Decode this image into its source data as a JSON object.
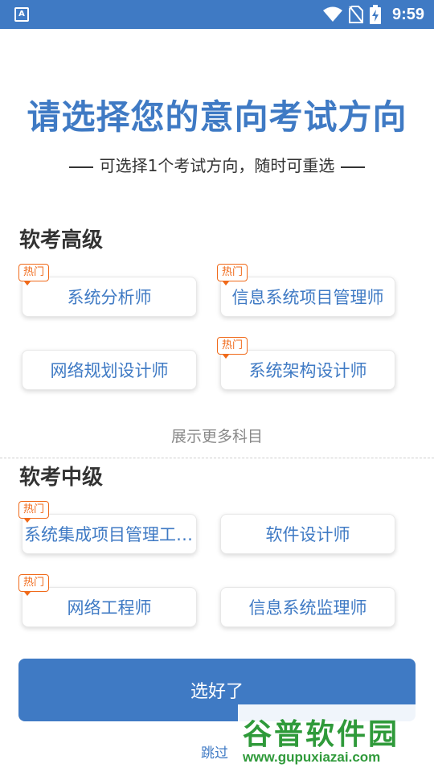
{
  "status_bar": {
    "left_icon": "A",
    "icons": [
      "wifi-icon",
      "no-sim-icon",
      "battery-charging-icon"
    ],
    "time": "9:59"
  },
  "header": {
    "title": "请选择您的意向考试方向",
    "subtitle": "可选择1个考试方向，随时可重选"
  },
  "sections": [
    {
      "title": "软考高级",
      "options": [
        {
          "label": "系统分析师",
          "hot": true
        },
        {
          "label": "信息系统项目管理师",
          "hot": true
        },
        {
          "label": "网络规划设计师",
          "hot": false
        },
        {
          "label": "系统架构设计师",
          "hot": true
        }
      ]
    },
    {
      "title": "软考中级",
      "options": [
        {
          "label": "系统集成项目管理工程师",
          "hot": true
        },
        {
          "label": "软件设计师",
          "hot": false
        },
        {
          "label": "网络工程师",
          "hot": true
        },
        {
          "label": "信息系统监理师",
          "hot": false
        }
      ]
    }
  ],
  "hot_label": "热门",
  "show_more": "展示更多科目",
  "confirm_label": "选好了",
  "skip_label": "跳过",
  "watermark": {
    "title": "谷普软件园",
    "url": "www.gupuxiazai.com"
  },
  "colors": {
    "accent": "#3f7ac4",
    "hot": "#f06a1a",
    "watermark": "#2f9a3a"
  }
}
